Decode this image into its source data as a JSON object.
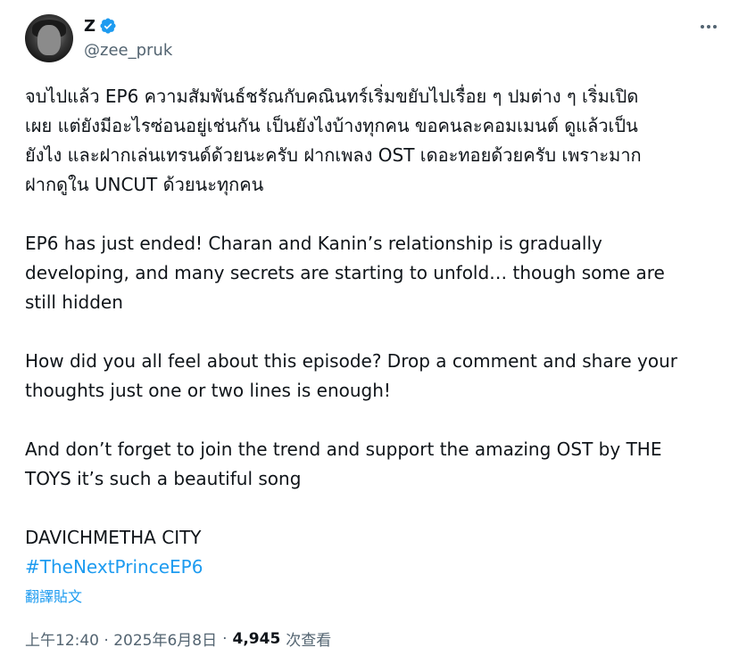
{
  "author": {
    "name": "Z",
    "handle": "@zee_pruk",
    "verified": true,
    "avatar_icon": "profile-photo"
  },
  "tweet": {
    "thai_text": "จบไปแล้ว EP6 ความสัมพันธ์ชรัณกับคณินทร์เริ่มขยับไปเรื่อย ๆ ปมต่าง ๆ เริ่มเปิด\nเผย แต่ยังมีอะไรซ่อนอยู่เช่นกัน เป็นยังไงบ้างทุกคน ขอคนละคอมเมนต์ ดูแล้วเป็น\nยังไง และฝากเล่นเทรนด์ด้วยนะครับ ฝากเพลง OST เดอะทอยด้วยครับ เพราะมาก\nฝากดูใน UNCUT ด้วยนะทุกคน",
    "english_1": "EP6 has just ended! Charan and Kanin’s relationship is gradually\ndeveloping, and many secrets are starting to unfold… though some are\nstill hidden",
    "english_2": "How did you all feel about this episode? Drop a comment and share your\nthoughts just one or two lines is enough!",
    "english_3": "And don’t forget to join the trend and support the amazing OST by THE\nTOYS it’s such a beautiful song",
    "tag_line": "DAVICHMETHA CITY",
    "hashtag": "#TheNextPrinceEP6"
  },
  "translate_label": "翻譯貼文",
  "meta": {
    "timestamp": "上午12:40 · 2025年6月8日",
    "separator": "·",
    "views_count": "4,945",
    "views_label": "次查看"
  },
  "colors": {
    "accent": "#1d9bf0",
    "secondary_text": "#536471",
    "primary_text": "#0f1419"
  }
}
